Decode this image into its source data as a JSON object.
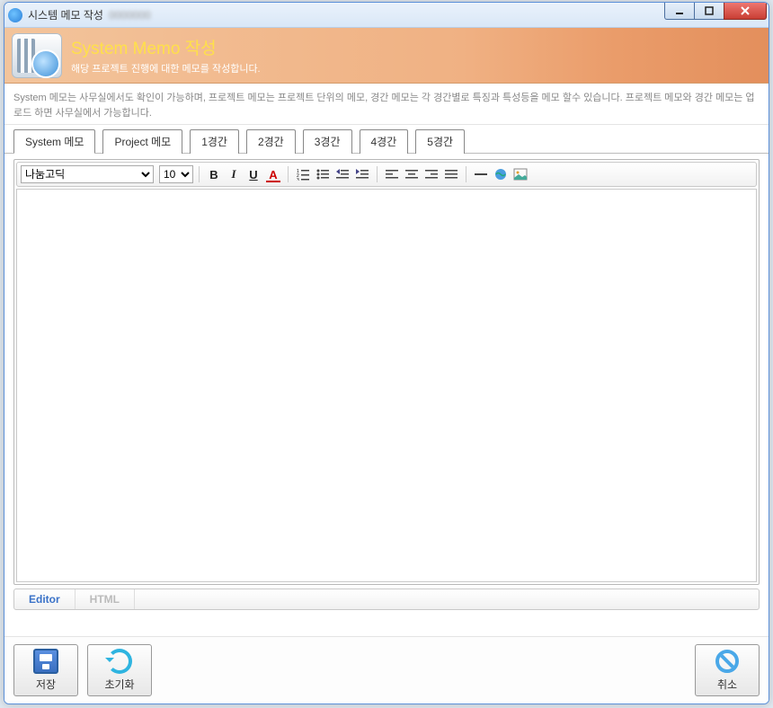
{
  "window": {
    "title": "시스템 메모 작성"
  },
  "header": {
    "title": "System Memo 작성",
    "subtitle": "해당 프로젝트 진행에 대한 메모를 작성합니다."
  },
  "description": "System 메모는 사무실에서도 확인이 가능하며, 프로젝트 메모는 프로젝트 단위의 메모, 경간 메모는 각 경간별로 특징과 특성등을 메모 할수 있습니다. 프로젝트 메모와 경간 메모는 업로드 하면 사무실에서 가능합니다.",
  "tabs": [
    {
      "label": "System 메모",
      "active": true
    },
    {
      "label": "Project 메모",
      "active": false
    },
    {
      "label": "1경간",
      "active": false
    },
    {
      "label": "2경간",
      "active": false
    },
    {
      "label": "3경간",
      "active": false
    },
    {
      "label": "4경간",
      "active": false
    },
    {
      "label": "5경간",
      "active": false
    }
  ],
  "editor": {
    "font": "나눔고딕",
    "font_size": "10",
    "mode_tabs": [
      {
        "label": "Editor",
        "active": true
      },
      {
        "label": "HTML",
        "active": false
      }
    ]
  },
  "buttons": {
    "save": "저장",
    "reset": "초기화",
    "cancel": "취소"
  }
}
